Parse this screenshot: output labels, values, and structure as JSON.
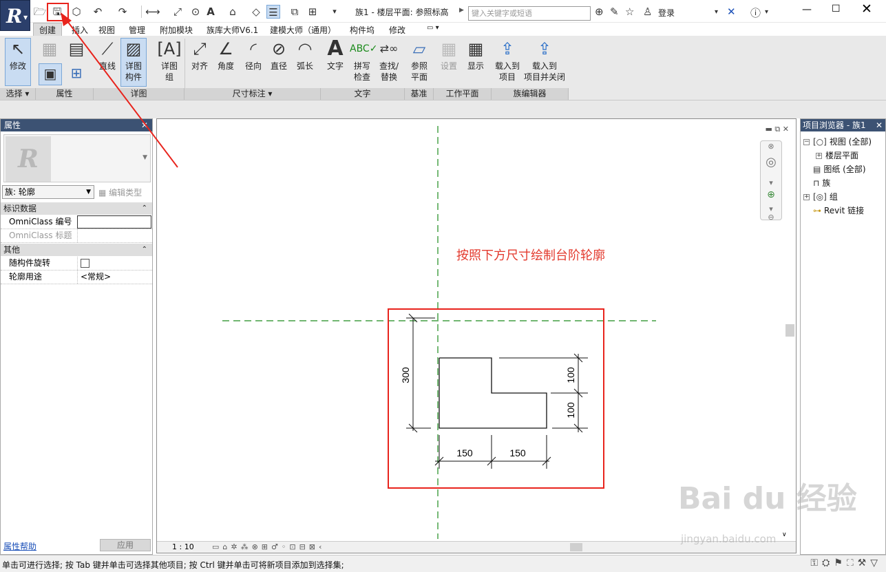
{
  "window": {
    "title": "族1 - 楼层平面: 参照标高",
    "search_placeholder": "键入关键字或短语",
    "login_label": "登录",
    "minimize": "—",
    "maximize": "☐",
    "close": "✕"
  },
  "tabs": [
    "创建",
    "插入",
    "视图",
    "管理",
    "附加模块",
    "族库大师V6.1",
    "建模大师（通用）",
    "构件坞",
    "修改",
    "▭ ▾"
  ],
  "ribbon": {
    "select": {
      "modify": "修改",
      "panel": "选择 ▾"
    },
    "properties": {
      "panel": "属性"
    },
    "detail": {
      "line": "直线",
      "component_l1": "详图",
      "component_l2": "构件",
      "group_l1": "详图",
      "group_l2": "组",
      "panel": "详图"
    },
    "dimension": {
      "aligned": "对齐",
      "angular": "角度",
      "radial": "径向",
      "diameter": "直径",
      "arc": "弧长",
      "panel": "尺寸标注 ▾"
    },
    "text": {
      "text": "文字",
      "spell_l1": "拼写",
      "spell_l2": "检查",
      "find_l1": "查找/",
      "find_l2": "替换",
      "panel": "文字"
    },
    "datum": {
      "ref_l1": "参照",
      "ref_l2": "平面",
      "panel": "基准"
    },
    "workplane": {
      "set": "设置",
      "show": "显示",
      "panel": "工作平面"
    },
    "family_editor": {
      "load_l1": "载入到",
      "load_l2": "项目",
      "loadclose_l1": "载入到",
      "loadclose_l2": "项目并关闭",
      "panel": "族编辑器"
    }
  },
  "properties": {
    "title": "属性",
    "family_select": "族: 轮廓",
    "edit_type": "编辑类型",
    "sections": [
      {
        "name": "标识数据",
        "rows": [
          {
            "key": "OmniClass 编号",
            "value": ""
          },
          {
            "key": "OmniClass 标题",
            "value": ""
          }
        ]
      },
      {
        "name": "其他",
        "rows": [
          {
            "key": "随构件旋转",
            "value": ""
          },
          {
            "key": "轮廓用途",
            "value": "<常规>"
          }
        ]
      }
    ],
    "help": "属性帮助",
    "apply": "应用"
  },
  "canvas": {
    "instruction": "按照下方尺寸绘制台阶轮廓",
    "scale": "1 : 10"
  },
  "dimensions": {
    "total_height": "300",
    "upper_height": "100",
    "lower_height": "100",
    "left_width": "150",
    "right_width": "150"
  },
  "browser": {
    "title": "项目浏览器 - 族1",
    "items": [
      "视图 (全部)",
      "楼层平面",
      "图纸 (全部)",
      "族",
      "组",
      "Revit 链接"
    ]
  },
  "status": {
    "text": "单击可进行选择; 按 Tab 键并单击可选择其他项目; 按 Ctrl 键并单击可将新项目添加到选择集;"
  },
  "watermark": {
    "main": "Bai du 经验",
    "sub": "jingyan.baidu.com"
  },
  "colors": {
    "accent_red": "#e8231c",
    "header_blue": "#3c5273",
    "ref_plane_green": "#1a8a1a"
  }
}
